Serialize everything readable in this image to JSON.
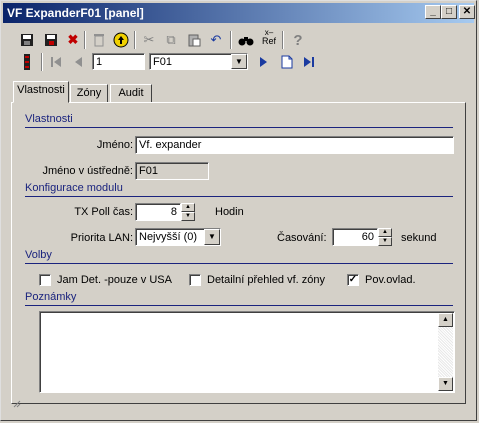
{
  "window": {
    "title": "VF ExpanderF01 [panel]",
    "min": "_",
    "max": "□",
    "close": "✕"
  },
  "nav": {
    "record_number": "1",
    "record_select": "F01",
    "ref_label": "Ref"
  },
  "tabs": [
    {
      "label": "Vlastnosti"
    },
    {
      "label": "Zóny"
    },
    {
      "label": "Audit"
    }
  ],
  "sections": {
    "vlastnosti": "Vlastnosti",
    "konfigurace": "Konfigurace modulu",
    "volby": "Volby",
    "poznamky": "Poznámky"
  },
  "fields": {
    "jmeno_label": "Jméno:",
    "jmeno_value": "Vf. expander",
    "jmeno_ustredne_label": "Jméno v ústředně:",
    "jmeno_ustredne_value": "F01",
    "tx_poll_label": "TX Poll čas:",
    "tx_poll_value": "8",
    "tx_poll_unit": "Hodin",
    "priorita_label": "Priorita LAN:",
    "priorita_value": "Nejvyšší (0)",
    "casovani_label": "Časování:",
    "casovani_value": "60",
    "casovani_unit": "sekund"
  },
  "options": [
    {
      "label": "Jam Det. -pouze v USA",
      "checked": false
    },
    {
      "label": "Detailní přehled vf. zóny",
      "checked": false
    },
    {
      "label": "Pov.ovlad.",
      "checked": true
    }
  ],
  "notes": ""
}
